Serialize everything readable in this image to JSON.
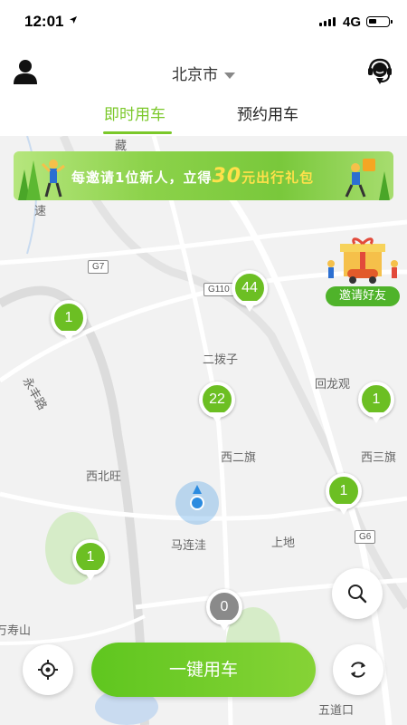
{
  "status_bar": {
    "time": "12:01",
    "network": "4G",
    "battery_level": 0.4
  },
  "header": {
    "city": "北京市"
  },
  "tabs": [
    {
      "label": "即时用车",
      "active": true
    },
    {
      "label": "预约用车",
      "active": false
    }
  ],
  "banner": {
    "text_before": "每邀请1位新人，立得",
    "amount": "30",
    "text_after": "元出行礼包"
  },
  "invite": {
    "label": "邀请好友"
  },
  "map": {
    "places": [
      "藏",
      "速",
      "永丰路",
      "二拨子",
      "回龙观",
      "西二旗",
      "西三旗",
      "西北旺",
      "马连洼",
      "上地",
      "五道口",
      "万寿山"
    ],
    "highways": [
      "G7",
      "G110",
      "G6"
    ]
  },
  "markers": [
    {
      "count": "44",
      "color": "green"
    },
    {
      "count": "1",
      "color": "green"
    },
    {
      "count": "22",
      "color": "green"
    },
    {
      "count": "1",
      "color": "green"
    },
    {
      "count": "1",
      "color": "green"
    },
    {
      "count": "1",
      "color": "green"
    },
    {
      "count": "0",
      "color": "grey"
    }
  ],
  "actions": {
    "call_label": "一键用车"
  },
  "colors": {
    "accent": "#7bc82a",
    "marker_green": "#6cbf23",
    "marker_grey": "#8a8a8a"
  }
}
